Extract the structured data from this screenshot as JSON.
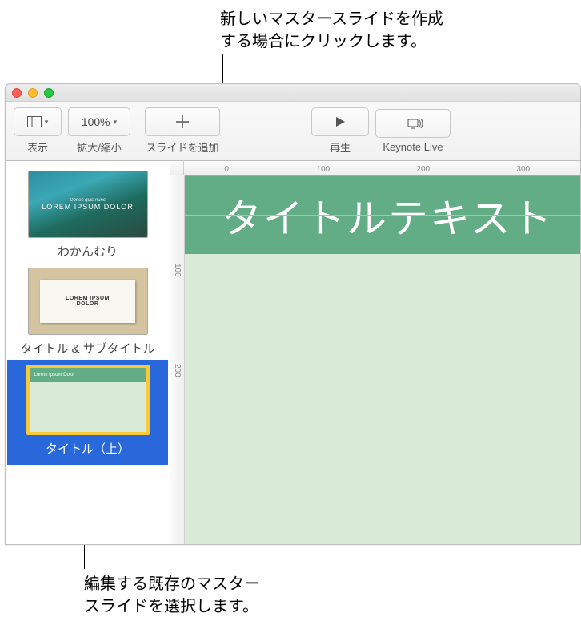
{
  "callouts": {
    "top": "新しいマスタースライドを作成\nする場合にクリックします。",
    "bottom": "編集する既存のマスター\nスライドを選択します。"
  },
  "toolbar": {
    "view_label": "表示",
    "zoom_value": "100%",
    "zoom_label": "拡大/縮小",
    "add_slide_label": "スライドを追加",
    "play_label": "再生",
    "keynote_live_label": "Keynote Live"
  },
  "sidebar": {
    "thumbs": [
      {
        "caption_small": "Donec quis nunc",
        "caption_big": "LOREM IPSUM DOLOR",
        "label": "わかんむり"
      },
      {
        "caption_line1": "LOREM IPSUM",
        "caption_line2": "DOLOR",
        "label": "タイトル & サブタイトル"
      },
      {
        "header": "Lorem Ipsum Dolor",
        "label": "タイトル（上）"
      }
    ]
  },
  "ruler": {
    "h_marks": [
      {
        "pos": 50,
        "label": "0"
      },
      {
        "pos": 165,
        "label": "100"
      },
      {
        "pos": 290,
        "label": "200"
      },
      {
        "pos": 415,
        "label": "300"
      }
    ],
    "v_marks": [
      {
        "pos": 110,
        "label": "100"
      },
      {
        "pos": 235,
        "label": "200"
      }
    ]
  },
  "slide": {
    "title": "タイトルテキスト"
  }
}
